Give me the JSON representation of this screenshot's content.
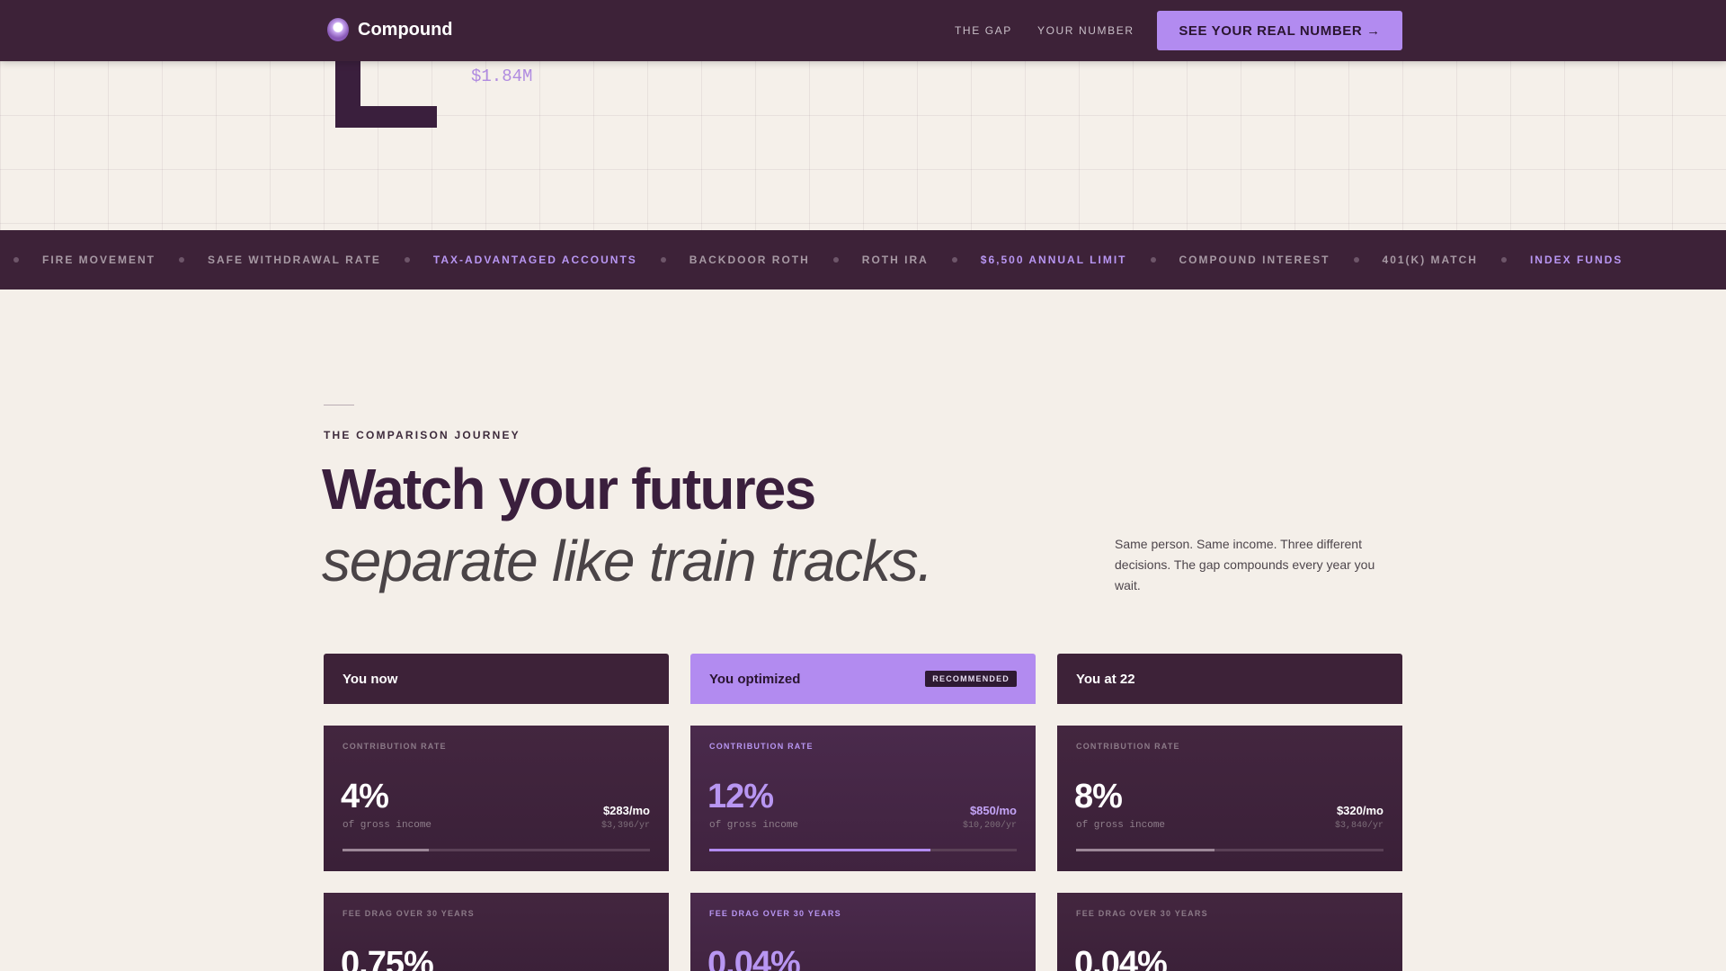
{
  "nav": {
    "brand": "Compound",
    "links": [
      "THE GAP",
      "YOUR NUMBER"
    ],
    "cta": "SEE YOUR REAL NUMBER →"
  },
  "hero": {
    "value": "$1.84M"
  },
  "ticker": {
    "items": [
      {
        "label": "FIRE MOVEMENT",
        "highlight": false
      },
      {
        "label": "SAFE WITHDRAWAL RATE",
        "highlight": false
      },
      {
        "label": "TAX-ADVANTAGED ACCOUNTS",
        "highlight": true
      },
      {
        "label": "BACKDOOR ROTH",
        "highlight": false
      },
      {
        "label": "ROTH IRA",
        "highlight": false
      },
      {
        "label": "$6,500 ANNUAL LIMIT",
        "highlight": true
      },
      {
        "label": "COMPOUND INTEREST",
        "highlight": false
      },
      {
        "label": "401(K) MATCH",
        "highlight": false
      },
      {
        "label": "INDEX FUNDS",
        "highlight": true
      }
    ]
  },
  "section": {
    "eyebrow": "THE COMPARISON JOURNEY",
    "headline": "Watch your futures",
    "subhead": "separate like train tracks.",
    "description": "Same person. Same income. Three different decisions. The gap compounds every year you wait."
  },
  "columns": [
    {
      "title": "You now",
      "badge": "",
      "contribution": {
        "label": "CONTRIBUTION RATE",
        "rate": "4%",
        "sub": "of gross income",
        "monthly": "$283/mo",
        "yearly": "$3,396/yr",
        "progress": 0.28
      },
      "fee": {
        "label": "FEE DRAG OVER 30 YEARS",
        "rate": "0.75%"
      }
    },
    {
      "title": "You optimized",
      "badge": "RECOMMENDED",
      "contribution": {
        "label": "CONTRIBUTION RATE",
        "rate": "12%",
        "sub": "of gross income",
        "monthly": "$850/mo",
        "yearly": "$10,200/yr",
        "progress": 0.72
      },
      "fee": {
        "label": "FEE DRAG OVER 30 YEARS",
        "rate": "0.04%"
      }
    },
    {
      "title": "You at 22",
      "badge": "",
      "contribution": {
        "label": "CONTRIBUTION RATE",
        "rate": "8%",
        "sub": "of gross income",
        "monthly": "$320/mo",
        "yearly": "$3,840/yr",
        "progress": 0.45
      },
      "fee": {
        "label": "FEE DRAG OVER 30 YEARS",
        "rate": "0.04%"
      }
    }
  ],
  "colors": {
    "plum": "#3d2238",
    "accent": "#b28bf0",
    "background": "#f4efe9"
  }
}
